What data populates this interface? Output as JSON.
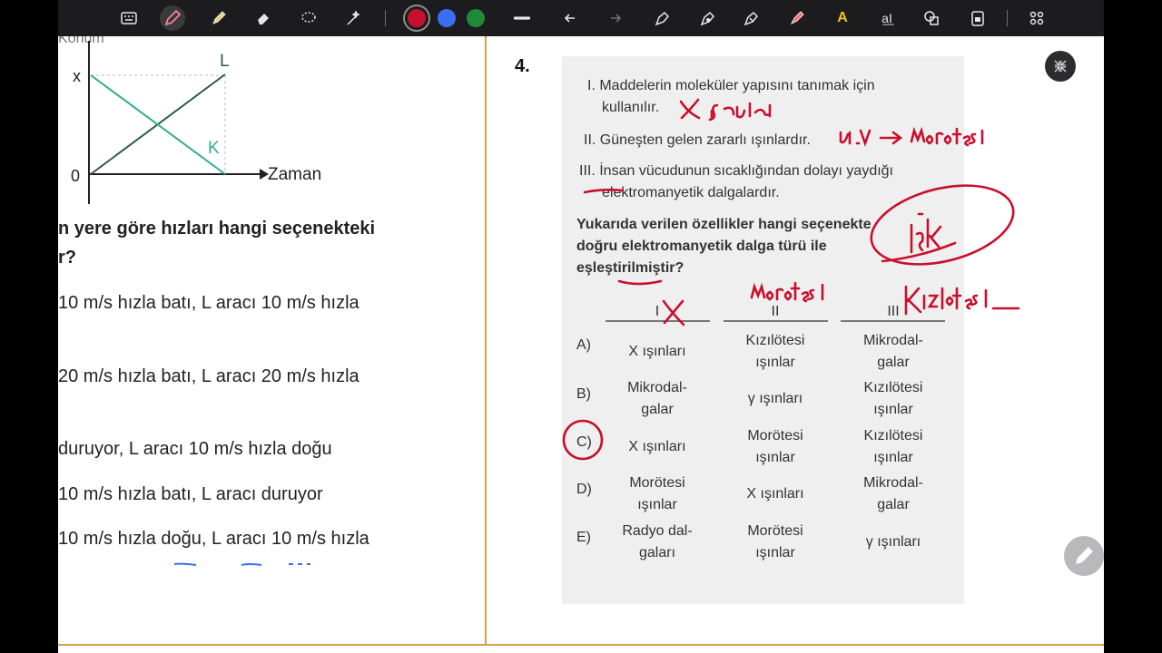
{
  "toolbar": {
    "tools": [
      "keyboard-icon",
      "pen-icon",
      "highlighter-icon",
      "eraser-icon",
      "lasso-icon",
      "magic-icon"
    ],
    "colors": [
      "#c8102e",
      "#3a6df0",
      "#1f8a3a"
    ],
    "actions": [
      "undo-icon",
      "redo-icon",
      "shape-pen-icon",
      "star-pen-icon",
      "ruler-pen-icon",
      "laser-icon",
      "text-highlight-icon",
      "text-box-icon",
      "shapes-icon",
      "lock-icon",
      "grid-icon"
    ],
    "text_highlight_glyph": "A",
    "text_box_glyph": "a͟I"
  },
  "left": {
    "graph": {
      "cut_label": "Konum",
      "y_label": "x",
      "origin": "0",
      "x_label": "Zaman",
      "line_L": "L",
      "line_K": "K"
    },
    "question": [
      "n yere göre hızları hangi seçenekteki",
      "r?"
    ],
    "options": [
      "10 m/s hızla batı, L aracı 10 m/s hızla",
      "20 m/s hızla batı, L aracı 20 m/s hızla",
      "duruyor, L aracı 10 m/s hızla doğu",
      "10 m/s hızla batı, L aracı duruyor",
      "10 m/s hızla doğu, L aracı 10 m/s hızla"
    ]
  },
  "right": {
    "number": "4.",
    "statements": [
      "I. Maddelerin moleküler yapısını tanımak için",
      "kullanılır.",
      "II. Güneşten gelen zararlı ışınlardır.",
      "III. İnsan vücudunun sıcaklığından dolayı yaydığı",
      "elektromanyetik dalgalardır."
    ],
    "prompt": [
      "Yukarıda verilen özellikler hangi seçenekte",
      "doğru elektromanyetik dalga türü ile",
      "eşleştirilmiştir?"
    ],
    "headers": [
      "I",
      "II",
      "III"
    ],
    "rows": [
      {
        "letter": "A)",
        "c1": [
          "X ışınları"
        ],
        "c2": [
          "Kızılötesi",
          "ışınlar"
        ],
        "c3": [
          "Mikrodal-",
          "galar"
        ]
      },
      {
        "letter": "B)",
        "c1": [
          "Mikrodal-",
          "galar"
        ],
        "c2": [
          "γ ışınları"
        ],
        "c3": [
          "Kızılötesi",
          "ışınlar"
        ]
      },
      {
        "letter": "C)",
        "c1": [
          "X ışınları"
        ],
        "c2": [
          "Morötesi",
          "ışınlar"
        ],
        "c3": [
          "Kızılötesi",
          "ışınlar"
        ]
      },
      {
        "letter": "D)",
        "c1": [
          "Morötesi",
          "ışınlar"
        ],
        "c2": [
          "X ışınları"
        ],
        "c3": [
          "Mikrodal-",
          "galar"
        ]
      },
      {
        "letter": "E)",
        "c1": [
          "Radyo dal-",
          "gaları"
        ],
        "c2": [
          "Morötesi",
          "ışınlar"
        ],
        "c3": [
          "γ ışınları"
        ]
      }
    ],
    "ink_color": "#c8102e"
  },
  "fabs": [
    "collapse-icon",
    "edit-pencil-icon"
  ]
}
